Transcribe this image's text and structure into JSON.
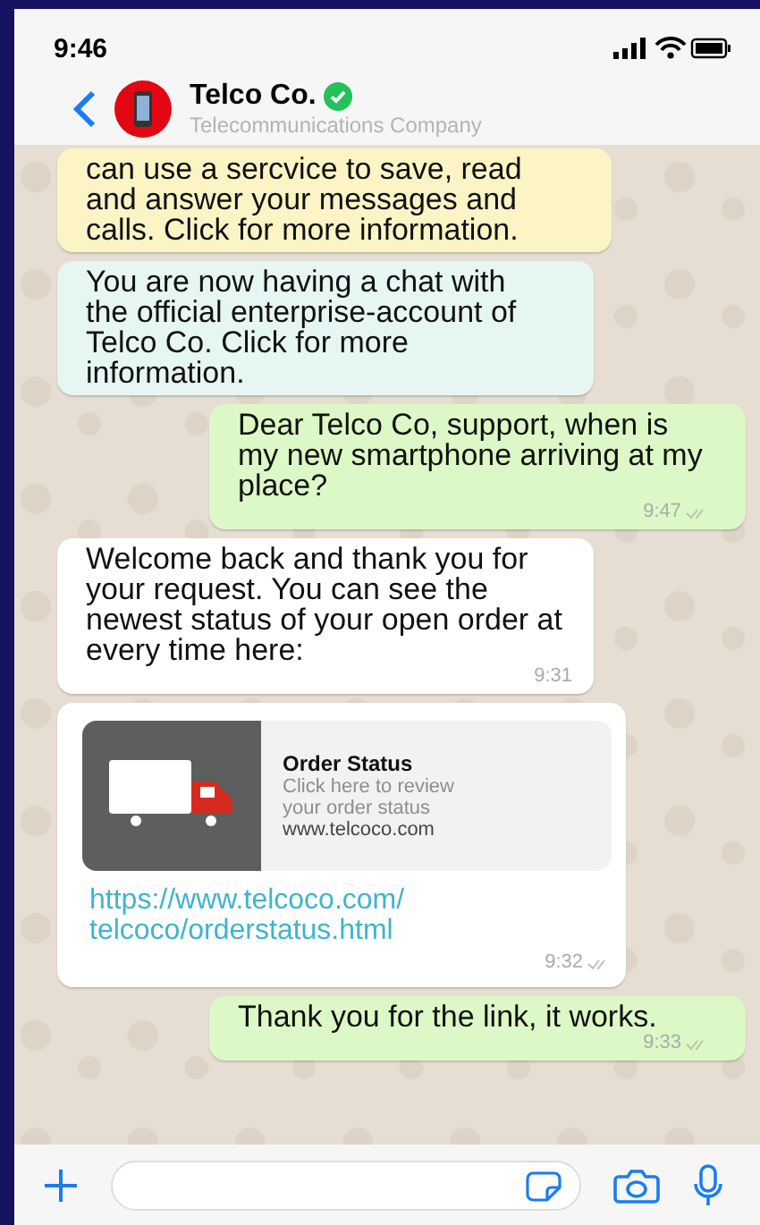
{
  "status_bar": {
    "time": "9:46"
  },
  "header": {
    "name": "Telco Co.",
    "verified": true,
    "subtitle": "Telecommunications Company"
  },
  "messages": [
    {
      "kind": "notice",
      "text": "can use a sercvice to save, read and answer your messages and calls. Click for more information."
    },
    {
      "kind": "info",
      "text": "You are now having a chat with the official enterprise-account of Telco Co. Click for more information."
    },
    {
      "kind": "outgoing",
      "text": "Dear Telco Co, support, when is my new smartphone arriving at my place?",
      "time": "9:47",
      "read": true
    },
    {
      "kind": "incoming",
      "text": "Welcome back and thank you for your request. You can see the newest status of your open order at every time here:",
      "time": "9:31"
    },
    {
      "kind": "link",
      "title": "Order Status",
      "description": "Click here to review your order status",
      "domain": "www.telcoco.com",
      "url": "https://www.telcoco.com/ telcoco/orderstatus.html",
      "time": "9:32",
      "read": true
    },
    {
      "kind": "outgoing",
      "text": "Thank you for the link, it works.",
      "time": "9:33",
      "read": true
    }
  ]
}
